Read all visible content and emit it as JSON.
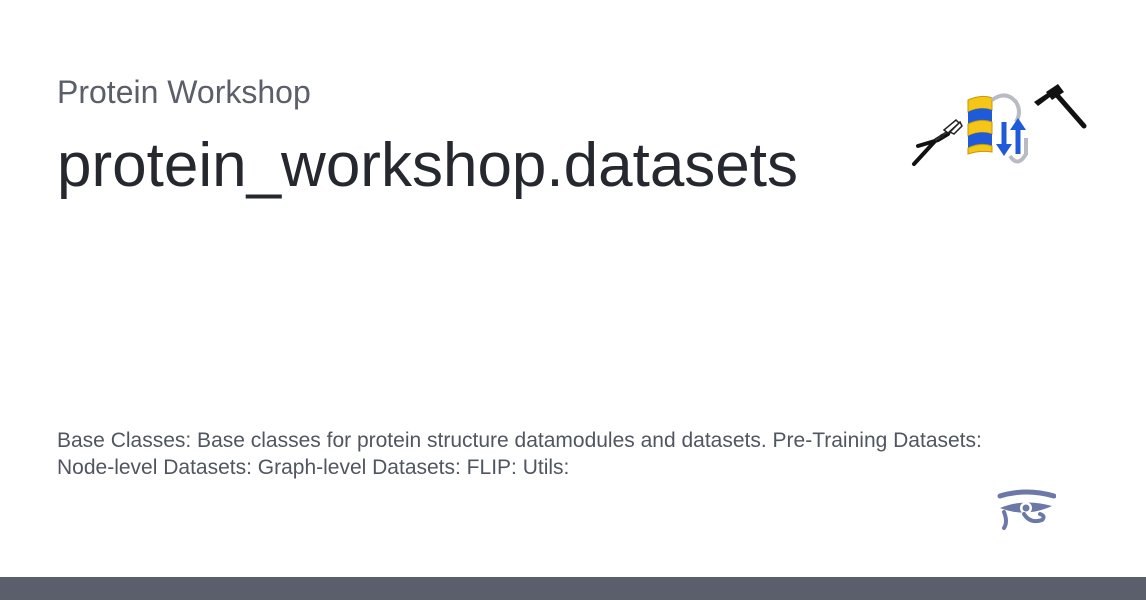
{
  "card": {
    "site_name": "Protein Workshop",
    "page_title": "protein_workshop.datasets",
    "description": "Base Classes: Base classes for protein structure datamodules and datasets. Pre-Training Datasets: Node-level Datasets: Graph-level Datasets: FLIP: Utils:"
  },
  "icons": {
    "logo": "pliers-protein-hammer-icon",
    "footer": "eye-of-horus-icon"
  },
  "colors": {
    "footer_bar": "#5a5f6b",
    "title_text": "#25282e",
    "subtitle_text": "#5a5f68",
    "helix_yellow": "#f5c518",
    "helix_blue": "#1f5bd8"
  }
}
